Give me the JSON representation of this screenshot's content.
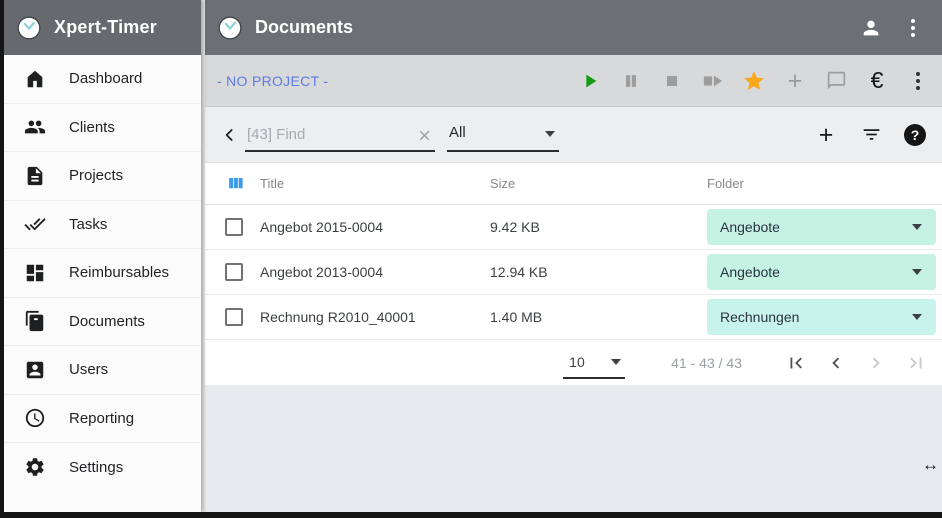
{
  "app": {
    "title": "Xpert-Timer"
  },
  "header": {
    "title": "Documents"
  },
  "sidebar": {
    "items": [
      {
        "label": "Dashboard",
        "icon": "home-icon"
      },
      {
        "label": "Clients",
        "icon": "people-icon"
      },
      {
        "label": "Projects",
        "icon": "document-icon"
      },
      {
        "label": "Tasks",
        "icon": "done-all-icon"
      },
      {
        "label": "Reimbursables",
        "icon": "dashboard-icon"
      },
      {
        "label": "Documents",
        "icon": "file-copy-icon"
      },
      {
        "label": "Users",
        "icon": "account-box-icon"
      },
      {
        "label": "Reporting",
        "icon": "clock-icon"
      },
      {
        "label": "Settings",
        "icon": "gear-icon"
      }
    ]
  },
  "toolbar": {
    "project_label": "- NO PROJECT -",
    "icons": [
      "play-icon",
      "pause-icon",
      "stop-icon",
      "stop-go-icon",
      "star-icon",
      "plus-icon",
      "comment-icon",
      "euro-icon",
      "more-vert-icon"
    ]
  },
  "search": {
    "placeholder": "[43] Find",
    "filter_selected": "All",
    "actions": [
      "add-icon",
      "filter-list-icon",
      "help-icon"
    ]
  },
  "icons": {
    "plus": "+",
    "help": "?",
    "euro": "€",
    "resize_cursor": "↔"
  },
  "table": {
    "columns": {
      "title": "Title",
      "size": "Size",
      "folder": "Folder"
    },
    "rows": [
      {
        "title": "Angebot 2015-0004",
        "size": "9.42 KB",
        "folder": "Angebote"
      },
      {
        "title": "Angebot 2013-0004",
        "size": "12.94 KB",
        "folder": "Angebote"
      },
      {
        "title": "Rechnung R2010_40001",
        "size": "1.40 MB",
        "folder": "Rechnungen"
      }
    ]
  },
  "pagination": {
    "page_size": "10",
    "range_label": "41 - 43 / 43"
  },
  "colors": {
    "accent_blue": "#5d7ce2",
    "mint_pill": "#c6f2e3",
    "cyan_pill": "#c8f3ec",
    "star_orange": "#f7a81b",
    "play_green": "#169a16",
    "columns_blue": "#3d9be9",
    "header_gray": "#6c7074",
    "toolbar_gray": "#d8d9da"
  }
}
